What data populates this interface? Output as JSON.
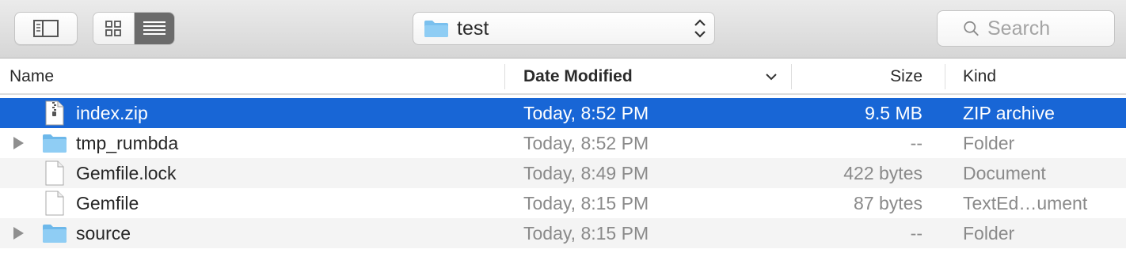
{
  "toolbar": {
    "sidebar_button_icon": "sidebar-icon",
    "view_modes": [
      {
        "name": "icon-view",
        "icon": "grid-icon",
        "selected": false
      },
      {
        "name": "list-view",
        "icon": "list-icon",
        "selected": true
      }
    ],
    "path": {
      "icon": "folder-icon",
      "label": "test"
    },
    "search": {
      "placeholder": "Search",
      "value": ""
    }
  },
  "columns": {
    "name": "Name",
    "date_modified": "Date Modified",
    "size": "Size",
    "kind": "Kind",
    "sort_column": "date_modified",
    "sort_direction": "descending"
  },
  "rows": [
    {
      "name": "index.zip",
      "date": "Today, 8:52 PM",
      "size": "9.5 MB",
      "kind": "ZIP archive",
      "type": "zip",
      "expandable": false,
      "selected": true
    },
    {
      "name": "tmp_rumbda",
      "date": "Today, 8:52 PM",
      "size": "--",
      "kind": "Folder",
      "type": "folder",
      "expandable": true,
      "selected": false
    },
    {
      "name": "Gemfile.lock",
      "date": "Today, 8:49 PM",
      "size": "422 bytes",
      "kind": "Document",
      "type": "document",
      "expandable": false,
      "selected": false
    },
    {
      "name": "Gemfile",
      "date": "Today, 8:15 PM",
      "size": "87 bytes",
      "kind": "TextEd…ument",
      "type": "document",
      "expandable": false,
      "selected": false
    },
    {
      "name": "source",
      "date": "Today, 8:15 PM",
      "size": "--",
      "kind": "Folder",
      "type": "folder",
      "expandable": true,
      "selected": false
    }
  ],
  "colors": {
    "selection": "#1866d6",
    "folder": "#7ac0ee",
    "alt_row": "#f4f4f4"
  }
}
